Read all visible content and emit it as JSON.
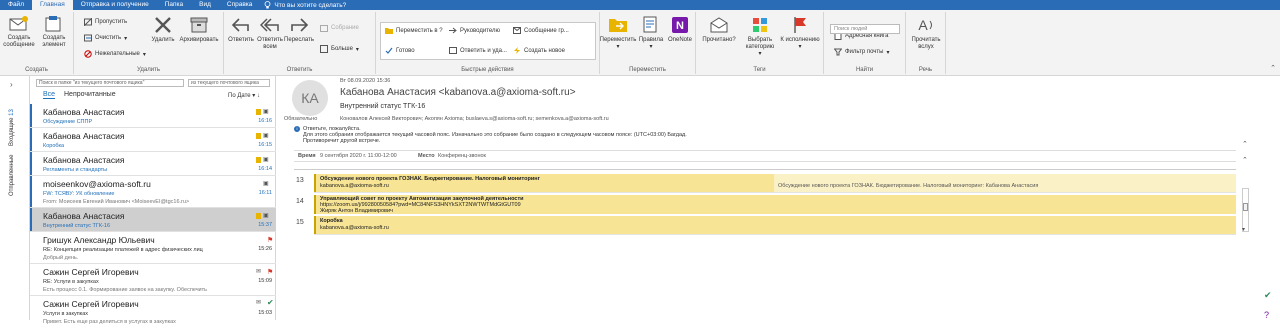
{
  "tabs": {
    "file": "Файл",
    "home": "Главная",
    "send_receive": "Отправка и получение",
    "folder": "Папка",
    "view": "Вид",
    "help": "Справка",
    "tell_me": "Что вы хотите сделать?"
  },
  "ribbon": {
    "new_email": "Создать сообщение",
    "new_items": "Создать элемент",
    "group_create": "Создать",
    "ignore": "Пропустить",
    "clean_up": "Очистить",
    "junk": "Нежелательные",
    "delete": "Удалить",
    "archive": "Архивировать",
    "group_delete": "Удалить",
    "reply": "Ответить",
    "reply_all": "Ответить всем",
    "forward": "Переслать",
    "meeting": "Собрание",
    "more": "Больше",
    "group_respond": "Ответить",
    "qs_move": "Переместить в ?",
    "qs_done": "Готово",
    "qs_manager": "Руководителю",
    "qs_reply_delete": "Ответить и уда...",
    "qs_team_email": "Сообщение гр...",
    "qs_create_new": "Создать новое",
    "group_quick": "Быстрые действия",
    "move": "Переместить",
    "rules": "Правила",
    "onenote": "OneNote",
    "group_move": "Переместить",
    "read": "Прочитано?",
    "categorize": "Выбрать категорию",
    "followup": "К исполнению",
    "group_tags": "Теги",
    "search_people": "Поиск людей",
    "address_book": "Адресная книга",
    "filter_email": "Фильтр почты",
    "group_find": "Найти",
    "read_aloud": "Прочитать вслух",
    "group_speech": "Речь"
  },
  "nav": {
    "inbox": "Входящие",
    "inbox_count": "13",
    "sent": "Отправленные"
  },
  "list": {
    "search_placeholder": "Поиск в папке \"из текущего почтового ящика\"",
    "scope": "из текущего почтового ящика",
    "filter_all": "Все",
    "filter_unread": "Непрочитанные",
    "sort": "По Дате",
    "items": [
      {
        "name": "Кабанова Анастасия",
        "subject": "Обсуждение СППР",
        "preview": "",
        "time": "16:16"
      },
      {
        "name": "Кабанова Анастасия",
        "subject": "Коробка",
        "preview": "",
        "time": "16:15"
      },
      {
        "name": "Кабанова Анастасия",
        "subject": "Регламенты и стандарты",
        "preview": "",
        "time": "16:14"
      },
      {
        "name": "moiseenkov@axioma-soft.ru",
        "subject": "FW: ТСЯВУ: УК обновление",
        "preview": "From: Моисеев Евгений Иванович <MoiseevEI@tgc16.ru>",
        "time": "16:11"
      },
      {
        "name": "Кабанова Анастасия",
        "subject": "Внутренний статус ТГК-16",
        "preview": "",
        "time": "15:37"
      },
      {
        "name": "Гришук Александр Юльевич",
        "subject": "RE: Концепция реализации платежей в адрес физических лиц",
        "preview": "Добрый день.",
        "time": "15:26"
      },
      {
        "name": "Сажин Сергей Игоревич",
        "subject": "RE: Услуги в закупках",
        "preview": "Есть процесс 0.1. Формирование заявок на закупку. Обеспечить",
        "time": "15:09"
      },
      {
        "name": "Сажин Сергей Игоревич",
        "subject": "Услуги в закупках",
        "preview": "Привет. Есть еще раз делиться в услугах в закупках",
        "time": "15:03"
      }
    ]
  },
  "reading": {
    "initials": "КА",
    "sent_date": "Вт 08.09.2020 15:36",
    "sender": "Кабанова Анастасия <kabanova.a@axioma-soft.ru>",
    "subject": "Внутренний статус ТГК-16",
    "required_label": "Обязательно",
    "attendees": "Коновалов Алексей Викторович; Акопян Axioma; buslaeva.s@axioma-soft.ru; semenkova.a@axioma-soft.ru",
    "info_line1": "Ответьте, пожалуйста.",
    "info_line2": "Для этого собрания отображается текущий часовой пояс. Изначально это собрание было создано в следующем часовом поясе: (UTC+03:00) Багдад.",
    "info_line3": "Противоречит другой встрече.",
    "when_label": "Время",
    "when_value": "9 сентября 2020 г. 11:00-12:00",
    "location_label": "Место",
    "location_value": "Конференц-звонок"
  },
  "calendar": {
    "rows": [
      "13",
      "14",
      "15"
    ],
    "events": [
      {
        "title": "Обсуждение нового проекта ГОЗНАК. Бюджетирование. Налоговый мониторинг",
        "line2": "kabanova.a@axioma-soft.ru",
        "line3": ""
      },
      {
        "title": "Управляющий совет по проекту Автоматизация закупочной деятельности",
        "line2": "https://zoom.us/j/99280050584?pwd=MC84NFS3HNYkSXT2NWTWTMdGtGUT09",
        "line3": "Жиряк Антон Владимирович"
      },
      {
        "title": "Коробка",
        "line2": "kabanova.a@axioma-soft.ru",
        "line3": ""
      }
    ],
    "conflict": "Обсуждение нового проекта ГОЗНАК. Бюджетирование. Налоговый мониторинг: Кабанова Анастасия"
  },
  "colors": {
    "accent": "#2b6cb7",
    "event": "#f7e495",
    "selected": "#cfcfcf"
  }
}
